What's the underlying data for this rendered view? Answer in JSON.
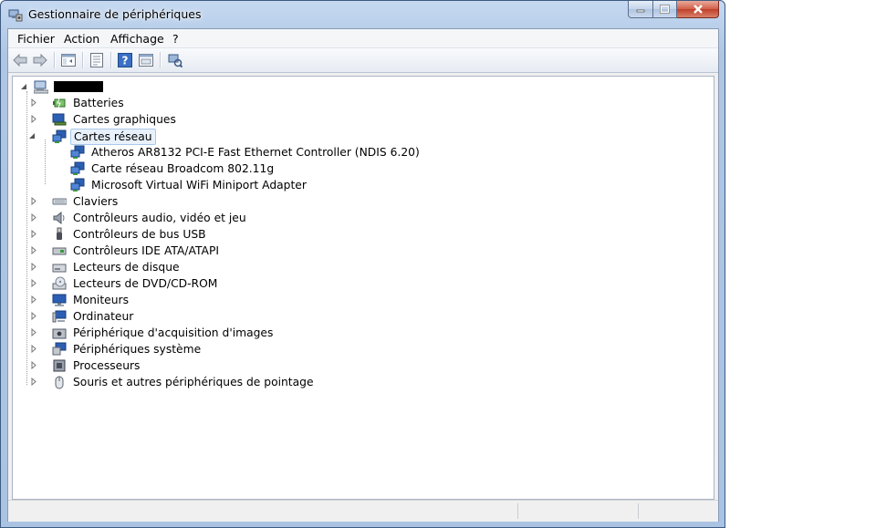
{
  "window": {
    "title": "Gestionnaire de périphériques"
  },
  "menu": {
    "items": [
      "Fichier",
      "Action",
      "Affichage",
      "?"
    ]
  },
  "toolbar": {
    "buttons": [
      "back-arrow-icon",
      "forward-arrow-icon",
      "show-hide-tree-icon",
      "properties-icon",
      "help-icon",
      "view-icon",
      "scan-hardware-icon"
    ]
  },
  "tree": {
    "root": {
      "label": ""
    },
    "categories": [
      {
        "label": "Batteries",
        "icon": "battery-icon",
        "expanded": false
      },
      {
        "label": "Cartes graphiques",
        "icon": "display-adapter-icon",
        "expanded": false
      },
      {
        "label": "Cartes réseau",
        "icon": "network-adapter-icon",
        "expanded": true,
        "selected": true,
        "children": [
          {
            "label": "Atheros AR8132 PCI-E Fast Ethernet Controller (NDIS 6.20)",
            "icon": "network-adapter-icon"
          },
          {
            "label": "Carte réseau Broadcom 802.11g",
            "icon": "network-adapter-icon"
          },
          {
            "label": "Microsoft Virtual WiFi Miniport Adapter",
            "icon": "network-adapter-icon"
          }
        ]
      },
      {
        "label": "Claviers",
        "icon": "keyboard-icon",
        "expanded": false
      },
      {
        "label": "Contrôleurs audio, vidéo et jeu",
        "icon": "speaker-icon",
        "expanded": false
      },
      {
        "label": "Contrôleurs de bus USB",
        "icon": "usb-icon",
        "expanded": false
      },
      {
        "label": "Contrôleurs IDE ATA/ATAPI",
        "icon": "ide-controller-icon",
        "expanded": false
      },
      {
        "label": "Lecteurs de disque",
        "icon": "disk-drive-icon",
        "expanded": false
      },
      {
        "label": "Lecteurs de DVD/CD-ROM",
        "icon": "dvd-drive-icon",
        "expanded": false
      },
      {
        "label": "Moniteurs",
        "icon": "monitor-icon",
        "expanded": false
      },
      {
        "label": "Ordinateur",
        "icon": "computer-icon",
        "expanded": false
      },
      {
        "label": "Périphérique d'acquisition d'images",
        "icon": "camera-icon",
        "expanded": false
      },
      {
        "label": "Périphériques système",
        "icon": "system-devices-icon",
        "expanded": false
      },
      {
        "label": "Processeurs",
        "icon": "processor-icon",
        "expanded": false
      },
      {
        "label": "Souris et autres périphériques de pointage",
        "icon": "mouse-icon",
        "expanded": false
      }
    ]
  },
  "statusbar": {
    "text": ""
  },
  "colors": {
    "selection": "#e8f1fb",
    "selection_border": "#a8c8ea",
    "close_button": "#c7432b"
  }
}
